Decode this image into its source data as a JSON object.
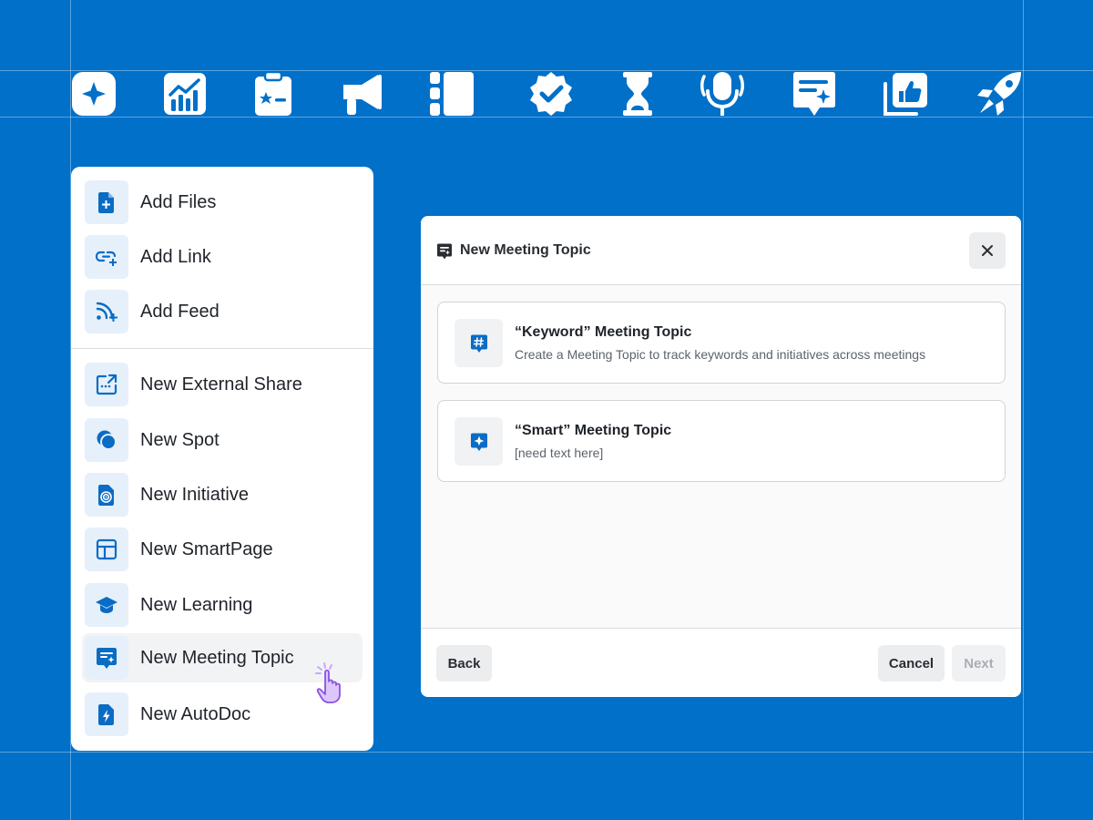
{
  "colors": {
    "background": "#0070c9",
    "accent": "#0a6cc4",
    "icon_tile": "#e6f0fa",
    "cursor": "#c9a8f5"
  },
  "icon_strip": [
    "sparkle-icon",
    "chart-icon",
    "clipboard-icon",
    "megaphone-icon",
    "sidebar-layout-icon",
    "verified-badge-icon",
    "hourglass-icon",
    "microphone-icon",
    "meeting-topic-icon",
    "thumbs-up-icon",
    "rocket-icon"
  ],
  "menu": {
    "items": [
      {
        "label": "Add Files",
        "icon": "file-add-icon"
      },
      {
        "label": "Add Link",
        "icon": "link-add-icon"
      },
      {
        "label": "Add Feed",
        "icon": "feed-add-icon"
      },
      {
        "label": "New External Share",
        "icon": "external-share-icon"
      },
      {
        "label": "New Spot",
        "icon": "spot-icon"
      },
      {
        "label": "New Initiative",
        "icon": "initiative-icon"
      },
      {
        "label": "New SmartPage",
        "icon": "smartpage-icon"
      },
      {
        "label": "New Learning",
        "icon": "learning-icon"
      },
      {
        "label": "New Meeting Topic",
        "icon": "meeting-topic-icon"
      },
      {
        "label": "New AutoDoc",
        "icon": "autodoc-icon"
      }
    ]
  },
  "dialog": {
    "title": "New Meeting Topic",
    "options": [
      {
        "title": "“Keyword” Meeting Topic",
        "description": "Create a Meeting Topic to track keywords and initiatives across meetings",
        "icon": "hashtag-icon"
      },
      {
        "title": "“Smart” Meeting Topic",
        "description": "[need text here]",
        "icon": "smart-sparkle-icon"
      }
    ],
    "buttons": {
      "back": "Back",
      "cancel": "Cancel",
      "next": "Next"
    }
  }
}
